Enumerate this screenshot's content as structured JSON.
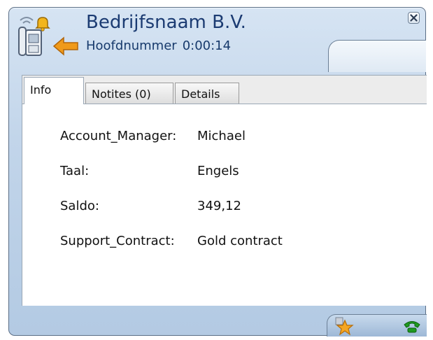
{
  "caller": {
    "company": "Bedrijfsnaam B.V.",
    "line": "Hoofdnummer",
    "duration": "0:00:14"
  },
  "tabs": [
    {
      "label": "Info",
      "active": true
    },
    {
      "label": "Notites (0)",
      "active": false
    },
    {
      "label": "Details",
      "active": false
    }
  ],
  "info": {
    "fields": [
      {
        "key": "Account_Manager:",
        "value": "Michael"
      },
      {
        "key": "Taal:",
        "value": "Engels"
      },
      {
        "key": "Saldo:",
        "value": "349,12"
      },
      {
        "key": "Support_Contract:",
        "value": "Gold contract"
      }
    ]
  },
  "icons": {
    "close": "close-icon",
    "caller": "desk-phone-icon",
    "bell": "bell-icon",
    "incoming": "incoming-arrow-icon",
    "favorite": "star-icon",
    "answer": "green-phone-icon"
  },
  "colors": {
    "window_bg": "#c2d5ea",
    "title_text": "#1b3b72",
    "arrow": "#f09a1a",
    "phone_green": "#1f9a1f"
  }
}
